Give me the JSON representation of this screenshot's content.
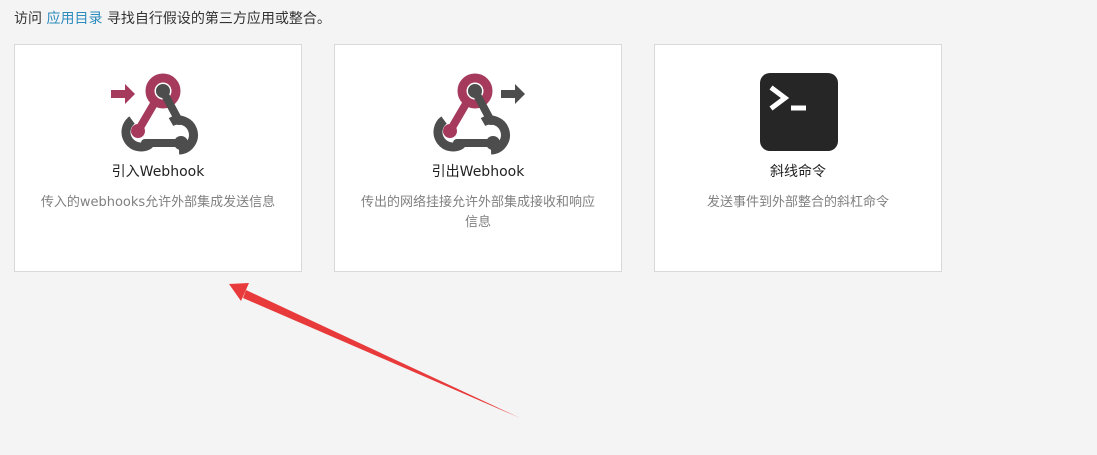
{
  "intro": {
    "prefix": "访问 ",
    "link": "应用目录",
    "suffix": " 寻找自行假设的第三方应用或整合。"
  },
  "cards": [
    {
      "title": "引入Webhook",
      "description": "传入的webhooks允许外部集成发送信息",
      "icon": "incoming-webhook-icon"
    },
    {
      "title": "引出Webhook",
      "description": "传出的网络挂接允许外部集成接收和响应信息",
      "icon": "outgoing-webhook-icon"
    },
    {
      "title": "斜线命令",
      "description": "发送事件到外部整合的斜杠命令",
      "icon": "terminal-icon"
    }
  ],
  "colors": {
    "webhook_accent": "#a63a5d",
    "webhook_dark": "#4d4d4d",
    "terminal_bg": "#262626",
    "link": "#2d8cbe",
    "annotation_arrow": "#e83a3a"
  }
}
